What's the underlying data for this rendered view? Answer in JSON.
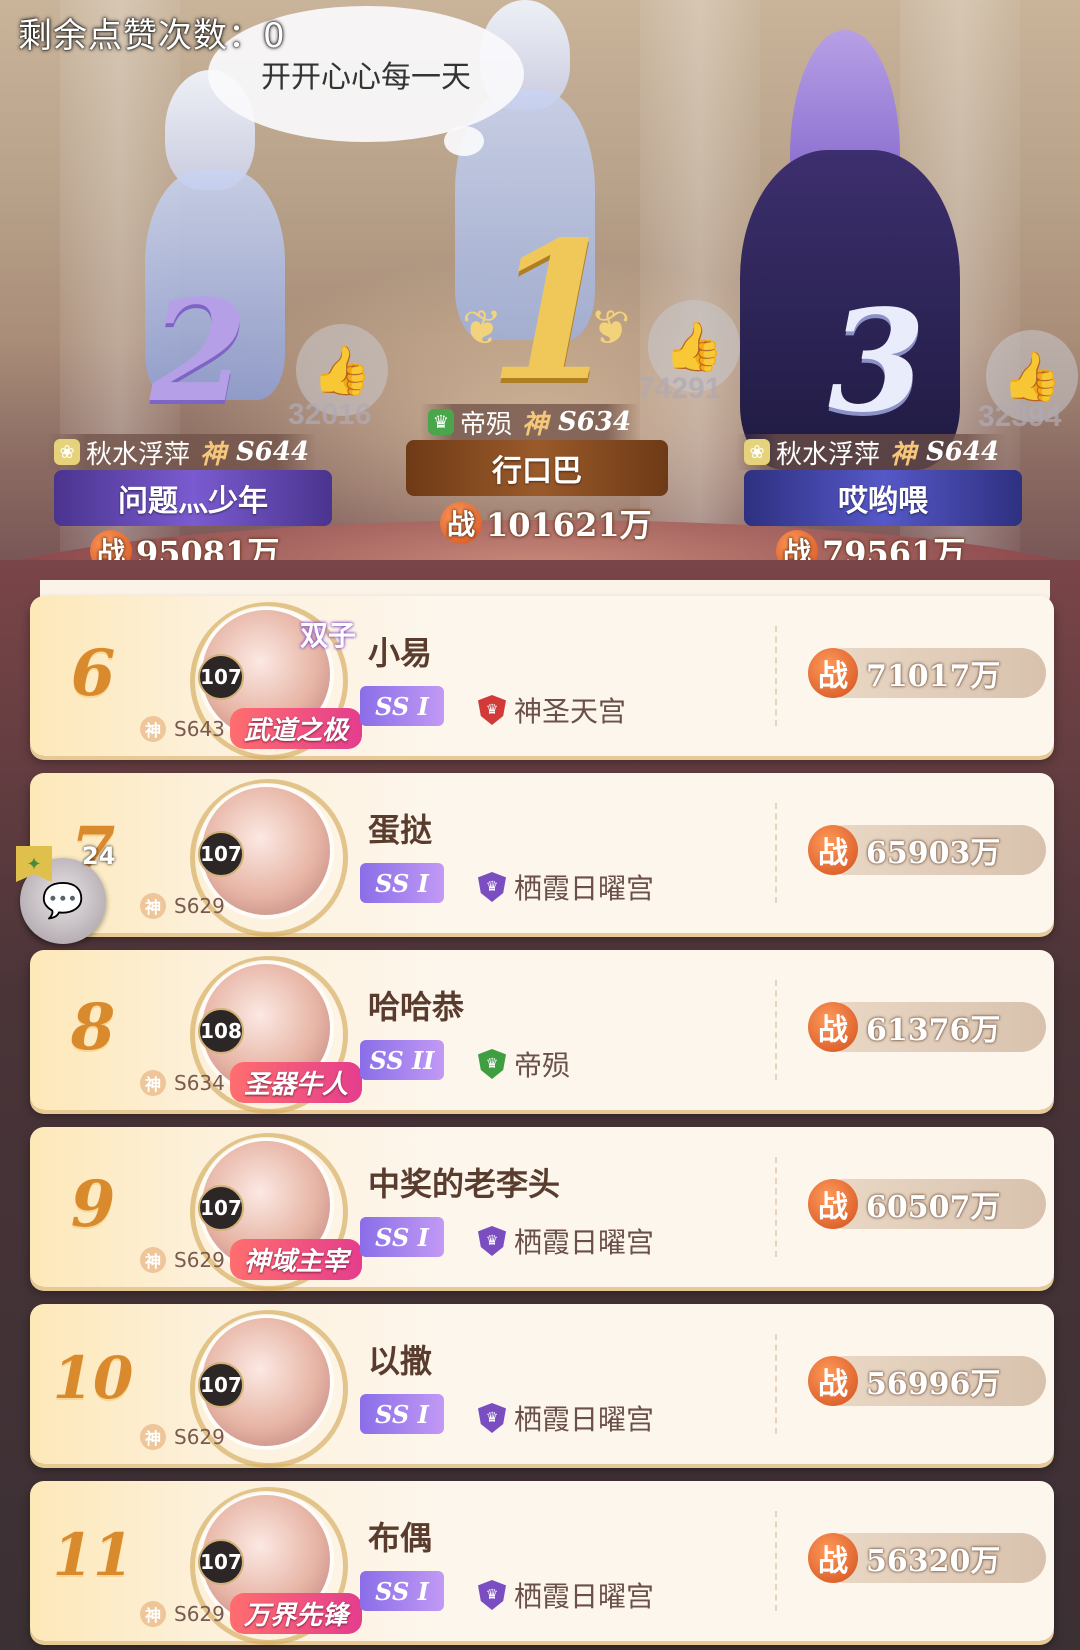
{
  "header": {
    "likes_remaining": "剩余点赞次数：0",
    "speech_bubble": "开开心心每一天"
  },
  "podium": [
    {
      "rank": "2",
      "likes": "32016",
      "guild": "秋水浮萍",
      "shen": "神",
      "server": "S644",
      "name": "问题灬少年",
      "power": "95081万",
      "plate_color": "#6a4cc0",
      "guild_icon_color": "#e6d27a"
    },
    {
      "rank": "1",
      "likes": "74291",
      "guild": "帝殒",
      "shen": "神",
      "server": "S634",
      "name": "行口巴",
      "power": "101621万",
      "plate_color": "#8a4e26",
      "guild_icon_color": "#4aa64a"
    },
    {
      "rank": "3",
      "likes": "32394",
      "guild": "秋水浮萍",
      "shen": "神",
      "server": "S644",
      "name": "哎哟喂",
      "power": "79561万",
      "plate_color": "#5050b8",
      "guild_icon_color": "#e6d27a"
    }
  ],
  "power_char": "战",
  "list": [
    {
      "rank": "6",
      "level": "107",
      "shen": "神",
      "server": "S643",
      "name": "小易",
      "tier": "SS I",
      "guild": "神圣天宫",
      "guild_color": "#d23a3a",
      "power": "71017万",
      "badge": "武道之极",
      "frame_tag": "双子"
    },
    {
      "rank": "7",
      "level": "107",
      "shen": "神",
      "server": "S629",
      "name": "蛋挞",
      "tier": "SS I",
      "guild": "栖霞日曜宫",
      "guild_color": "#7a4ec0",
      "power": "65903万",
      "badge": "",
      "frame_tag": ""
    },
    {
      "rank": "8",
      "level": "108",
      "shen": "神",
      "server": "S634",
      "name": "哈哈恭",
      "tier": "SS II",
      "guild": "帝殒",
      "guild_color": "#3f9e3f",
      "power": "61376万",
      "badge": "圣器牛人",
      "frame_tag": ""
    },
    {
      "rank": "9",
      "level": "107",
      "shen": "神",
      "server": "S629",
      "name": "中奖的老李头",
      "tier": "SS I",
      "guild": "栖霞日曜宫",
      "guild_color": "#7a4ec0",
      "power": "60507万",
      "badge": "神域主宰",
      "frame_tag": ""
    },
    {
      "rank": "10",
      "level": "107",
      "shen": "神",
      "server": "S629",
      "name": "以撒",
      "tier": "SS I",
      "guild": "栖霞日曜宫",
      "guild_color": "#7a4ec0",
      "power": "56996万",
      "badge": "",
      "frame_tag": ""
    },
    {
      "rank": "11",
      "level": "107",
      "shen": "神",
      "server": "S629",
      "name": "布偶",
      "tier": "SS I",
      "guild": "栖霞日曜宫",
      "guild_color": "#7a4ec0",
      "power": "56320万",
      "badge": "万界先锋",
      "frame_tag": ""
    }
  ],
  "chat": {
    "count": "24",
    "icon": "chat-bubble-icon"
  }
}
